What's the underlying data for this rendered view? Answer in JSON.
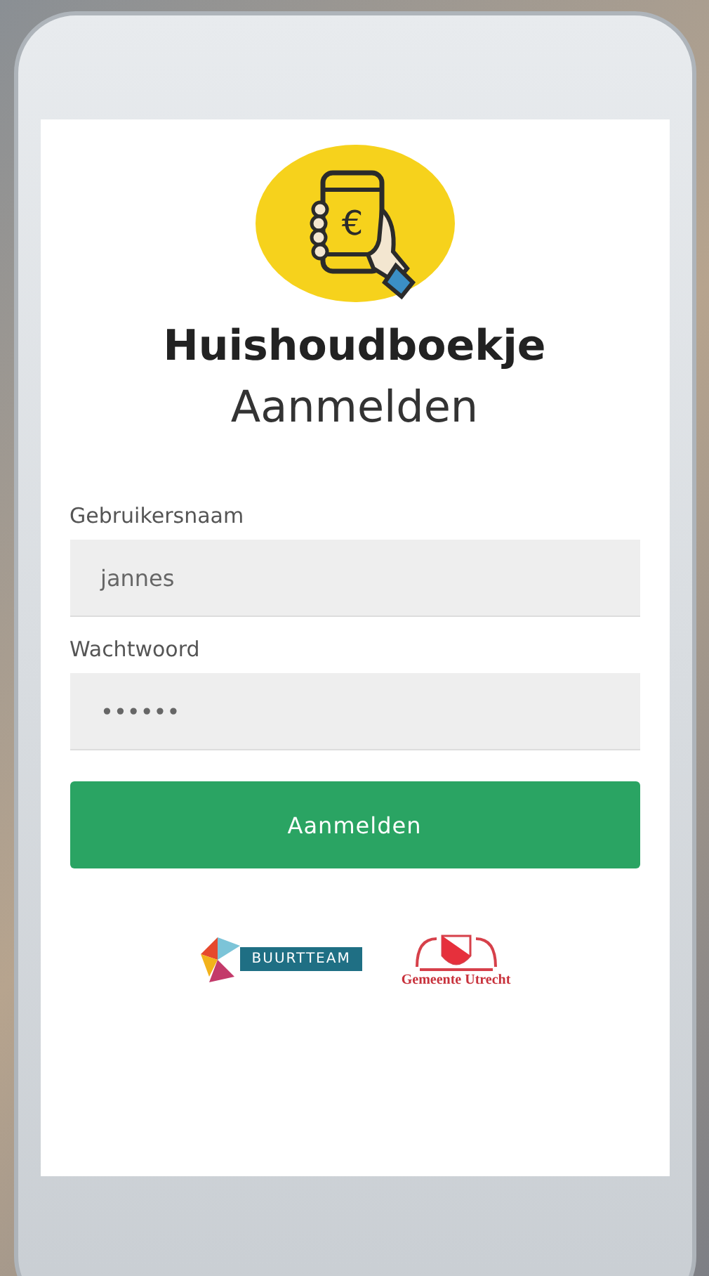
{
  "app": {
    "logo_symbol": "€",
    "name": "Huishoudboekje",
    "subtitle": "Aanmelden"
  },
  "form": {
    "fields": [
      {
        "label": "Gebruikersnaam",
        "value": "jannes"
      },
      {
        "label": "Wachtwoord",
        "value": "••••••"
      }
    ],
    "submit": "Aanmelden"
  },
  "partners": [
    {
      "kind": "buurtteam",
      "name": "BUURTTEAM"
    },
    {
      "kind": "gemeente",
      "name": "Gemeente Utrecht"
    }
  ]
}
